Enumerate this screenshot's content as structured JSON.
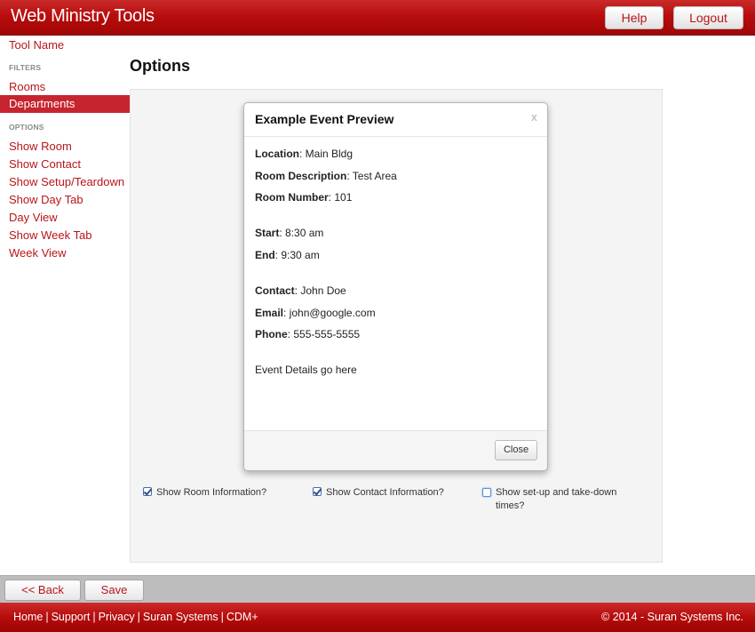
{
  "header": {
    "brand": "Web Ministry Tools",
    "help_label": "Help",
    "logout_label": "Logout"
  },
  "sidebar": {
    "tool_name": "Tool Name",
    "filters_heading": "FILTERS",
    "filters": [
      "Rooms",
      "Departments"
    ],
    "active_filter": "Departments",
    "options_heading": "OPTIONS",
    "options": [
      "Show Room",
      "Show Contact",
      "Show Setup/Teardown",
      "Show Day Tab",
      "Day View",
      "Show Week Tab",
      "Week View"
    ]
  },
  "main": {
    "title": "Options",
    "checkboxes": [
      {
        "label": "Show Room Information?",
        "checked": true
      },
      {
        "label": "Show Contact Information?",
        "checked": true
      },
      {
        "label_line1": "Show set-up and take-down",
        "label_line2": "times?",
        "checked": false
      }
    ]
  },
  "modal": {
    "title": "Example Event Preview",
    "close_x": "x",
    "location_label": "Location",
    "location_value": ": Main Bldg",
    "room_desc_label": "Room Description",
    "room_desc_value": ": Test Area",
    "room_number_label": "Room Number",
    "room_number_value": ": 101",
    "start_label": "Start",
    "start_value": ": 8:30 am",
    "end_label": "End",
    "end_value": ": 9:30 am",
    "contact_label": "Contact",
    "contact_value": ": John Doe",
    "email_label": "Email",
    "email_value": ": john@google.com",
    "phone_label": "Phone",
    "phone_value": ": 555-555-5555",
    "details": "Event Details go here",
    "close_button": "Close"
  },
  "actionbar": {
    "back_label": "<< Back",
    "save_label": "Save"
  },
  "footer": {
    "links": [
      "Home",
      "Support",
      "Privacy",
      "Suran Systems",
      "CDM+"
    ],
    "separator": "|",
    "copyright": "© 2014 - Suran Systems Inc."
  },
  "colors": {
    "brand_red": "#b8151a",
    "header_red": "#b80d0d",
    "active_nav": "#c6252f"
  }
}
